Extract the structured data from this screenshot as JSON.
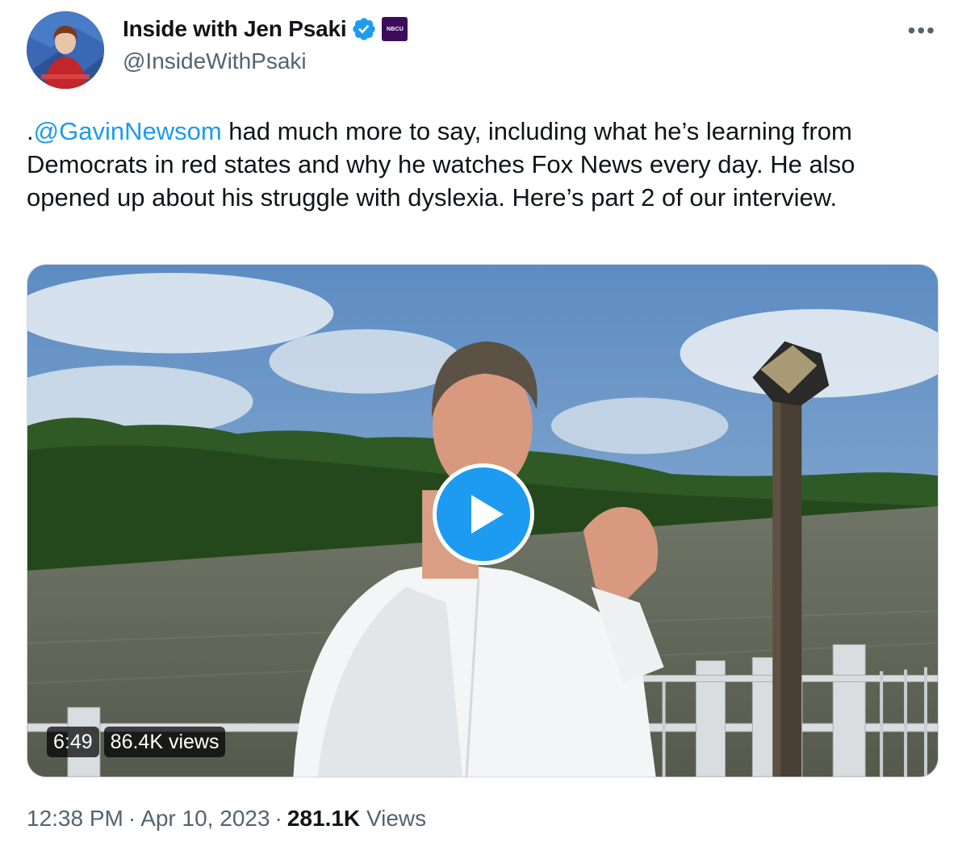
{
  "author": {
    "display_name": "Inside with Jen Psaki",
    "handle": "@InsideWithPsaki",
    "org_badge": "NBCU",
    "verified_icon": "verified-badge-icon",
    "avatar": "profile-photo"
  },
  "more_icon": "more-options-icon",
  "tweet": {
    "prefix": ".",
    "mention": "@GavinNewsom",
    "body": " had much more to say, including what he’s learning from Democrats in red states and why he watches Fox News every day. He also opened up about his  struggle with dyslexia. Here’s part 2 of our interview."
  },
  "video": {
    "duration": "6:49",
    "views": "86.4K views",
    "play_icon": "play-icon"
  },
  "meta": {
    "time": "12:38 PM",
    "dot1": "·",
    "date": "Apr 10, 2023",
    "dot2": "·",
    "views_count": "281.1K",
    "views_label": "Views"
  },
  "colors": {
    "accent": "#1d9bf0",
    "text": "#0f1419",
    "secondary": "#536471"
  }
}
